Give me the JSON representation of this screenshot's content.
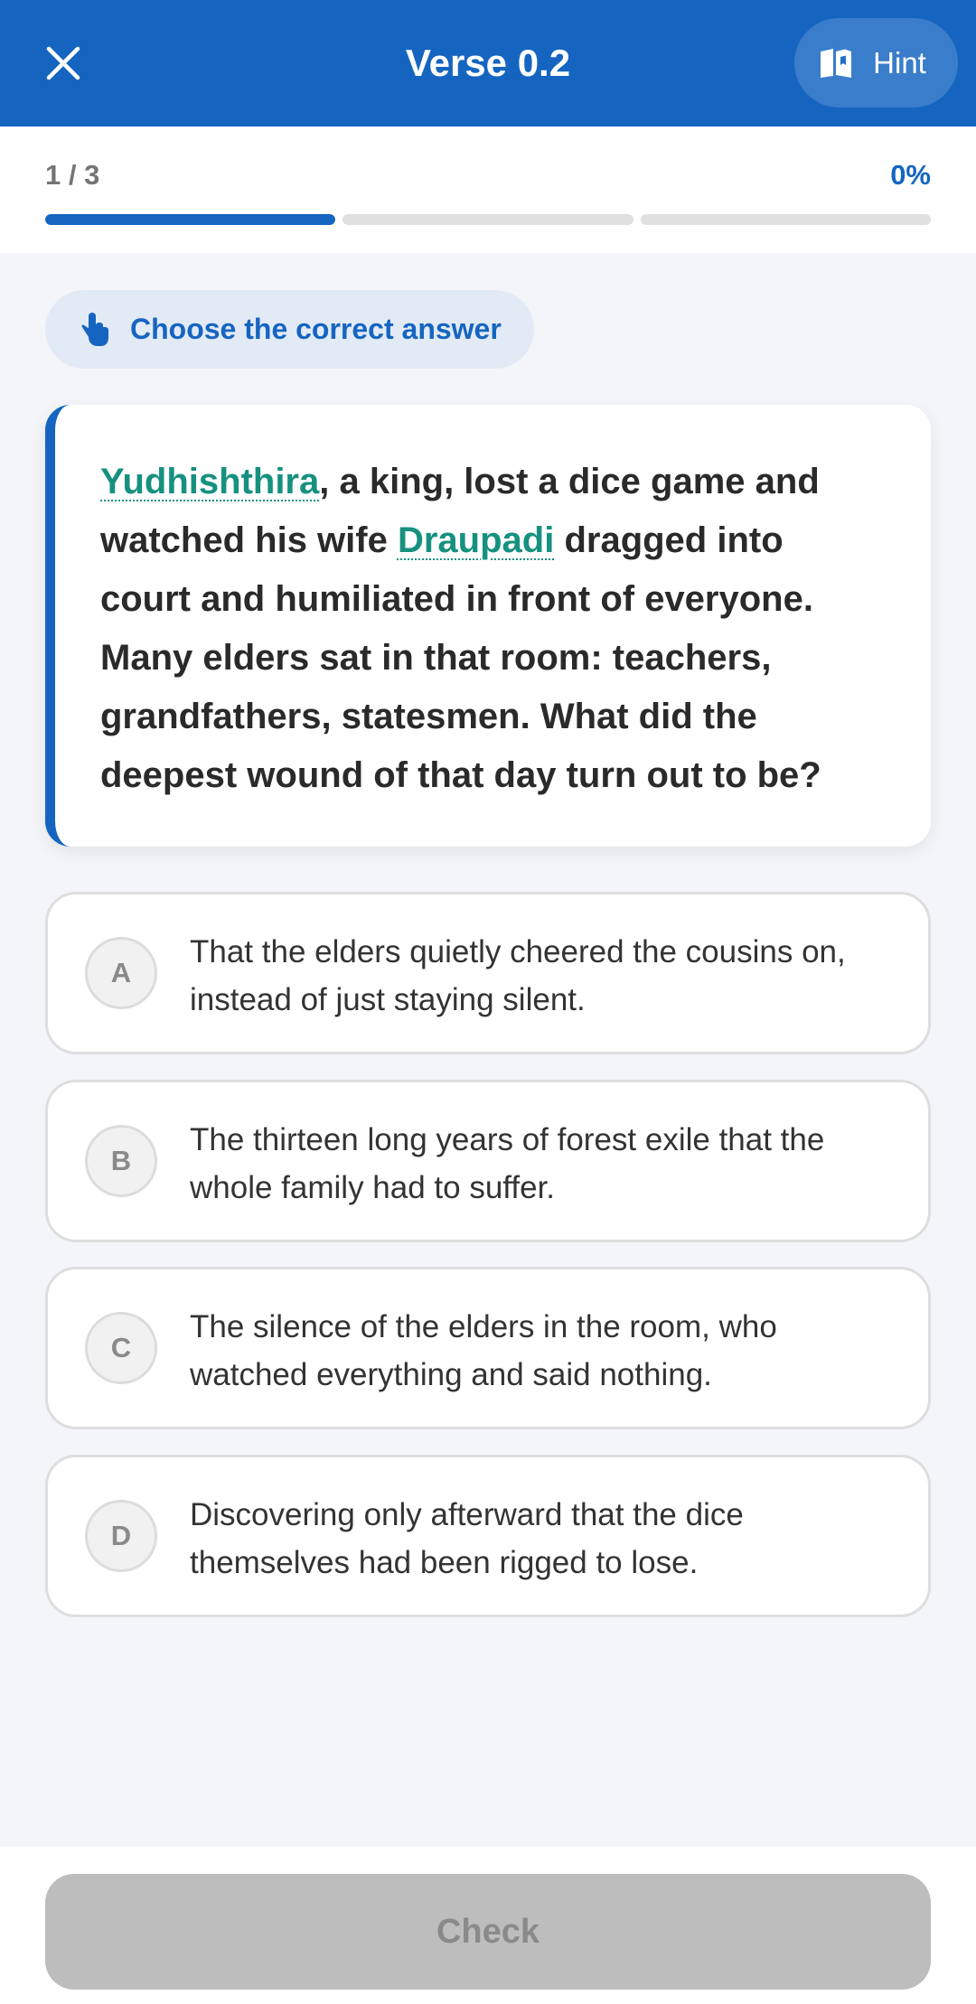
{
  "header": {
    "title": "Verse 0.2",
    "close_icon": "close-icon",
    "hint_label": "Hint",
    "hint_icon": "book-icon",
    "background_color": "#1565c0"
  },
  "progress": {
    "step_label": "1 / 3",
    "percent_label": "0%",
    "current_step": 1,
    "total_steps": 3,
    "accent_color": "#1565c0"
  },
  "instruction": {
    "label": "Choose the correct answer",
    "icon": "tap-pointer-icon"
  },
  "question": {
    "term_1": "Yudhishthira",
    "segment_1": ", a king, lost a dice game and watched his wife ",
    "term_2": "Draupadi",
    "segment_2": " dragged into court and humiliated in front of everyone. Many elders sat in that room: teachers, grandfathers, statesmen. What did the deepest wound of that day turn out to be?",
    "term_color": "#16917f"
  },
  "options": [
    {
      "letter": "A",
      "text": "That the elders quietly cheered the cousins on, instead of just staying silent."
    },
    {
      "letter": "B",
      "text": "The thirteen long years of forest exile that the whole family had to suffer."
    },
    {
      "letter": "C",
      "text": "The silence of the elders in the room, who watched everything and said nothing."
    },
    {
      "letter": "D",
      "text": "Discovering only afterward that the dice themselves had been rigged to lose."
    }
  ],
  "footer": {
    "check_label": "Check",
    "check_enabled": false
  }
}
